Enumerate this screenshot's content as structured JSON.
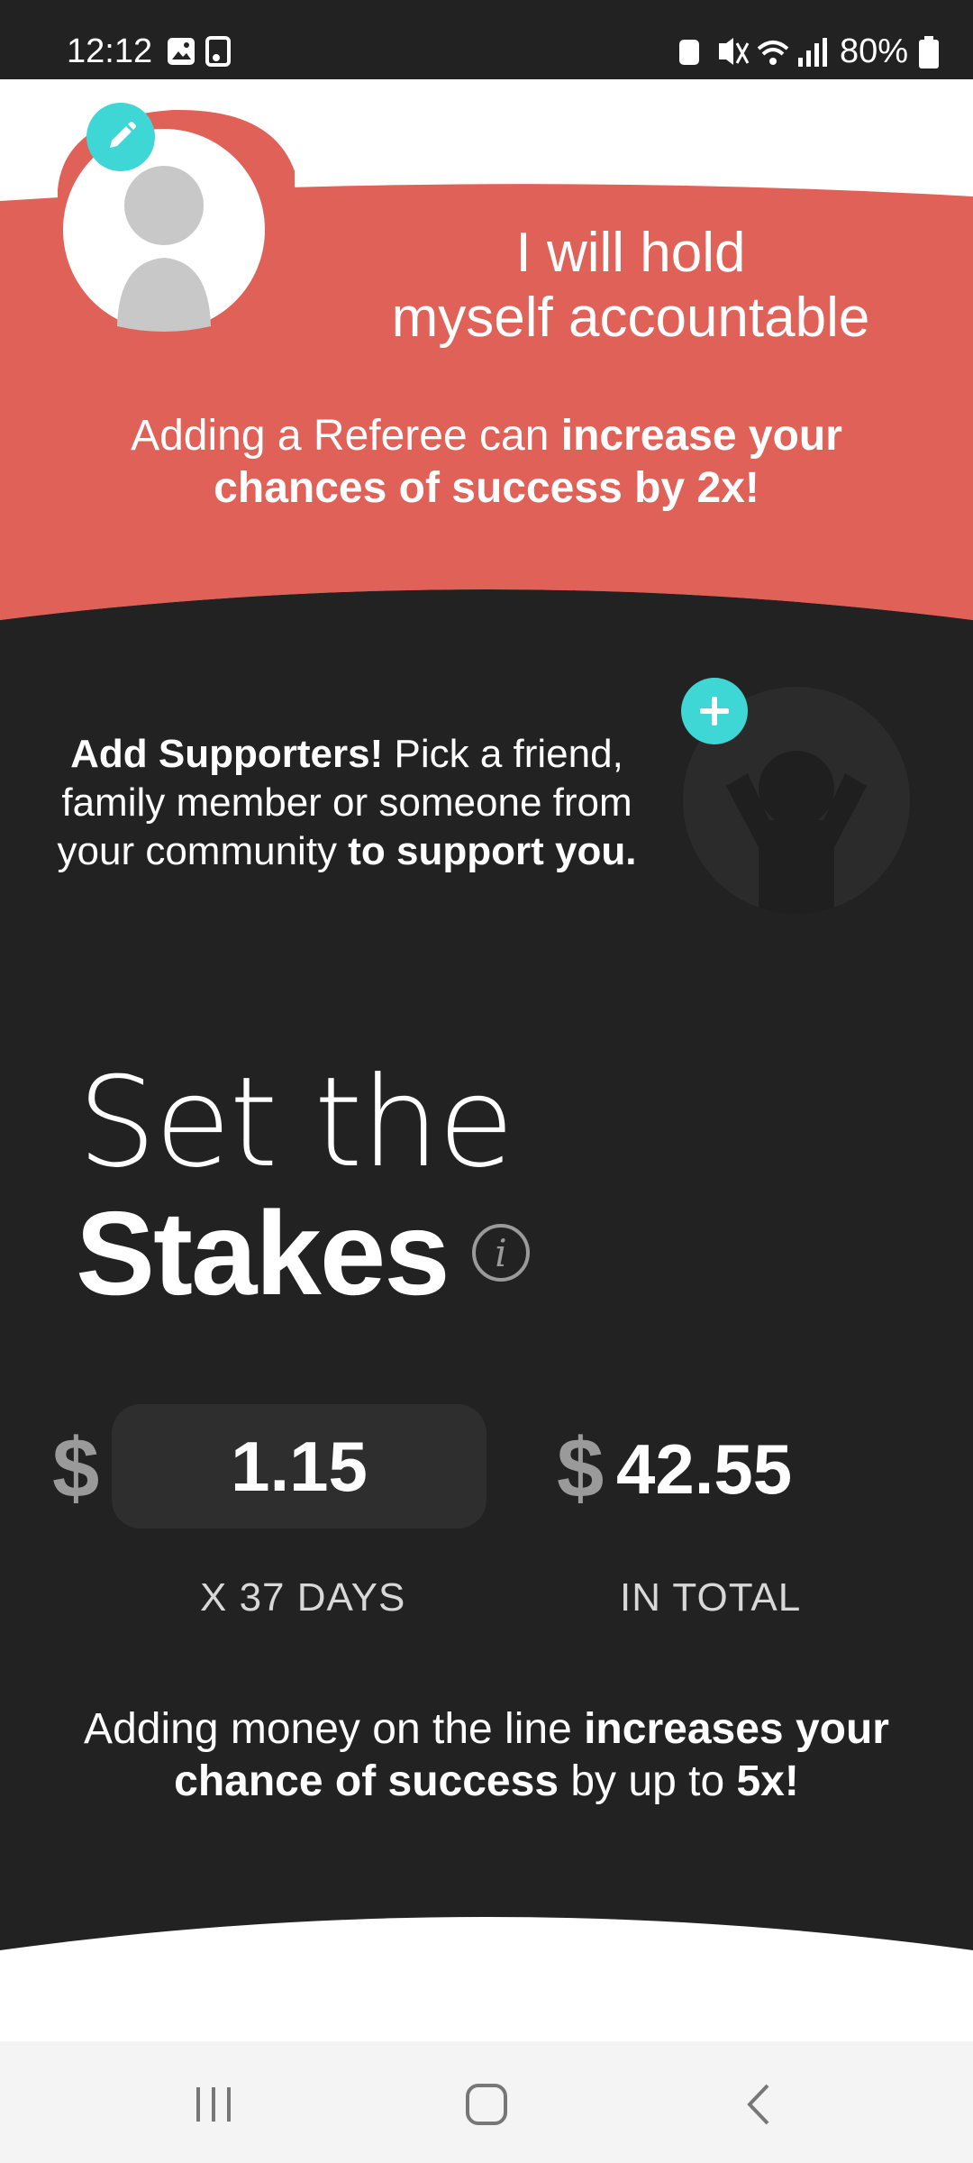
{
  "status_bar": {
    "time": "12:12",
    "battery": "80%"
  },
  "pledge": {
    "line1": "I will hold",
    "line2": "myself accountable"
  },
  "referee_tip": {
    "part1": "Adding a Referee can ",
    "bold": "increase your chances of success by 2x!"
  },
  "supporters": {
    "bold1": "Add Supporters!",
    "text1": " Pick a friend, family member or someone from your community ",
    "bold2": "to support you."
  },
  "stakes": {
    "title_light": "Set the",
    "title_bold": "Stakes",
    "currency_symbol": "$",
    "daily_amount": "1.15",
    "total_amount": "42.55",
    "days_caption": "X 37 DAYS",
    "total_caption": "IN TOTAL"
  },
  "money_tip": {
    "part1": "Adding money on the line ",
    "bold1": "increases your chance of success",
    "part2": " by up to ",
    "bold2": "5x!"
  },
  "colors": {
    "coral": "#e06158",
    "teal": "#3fd6d6",
    "dark": "#222222"
  }
}
